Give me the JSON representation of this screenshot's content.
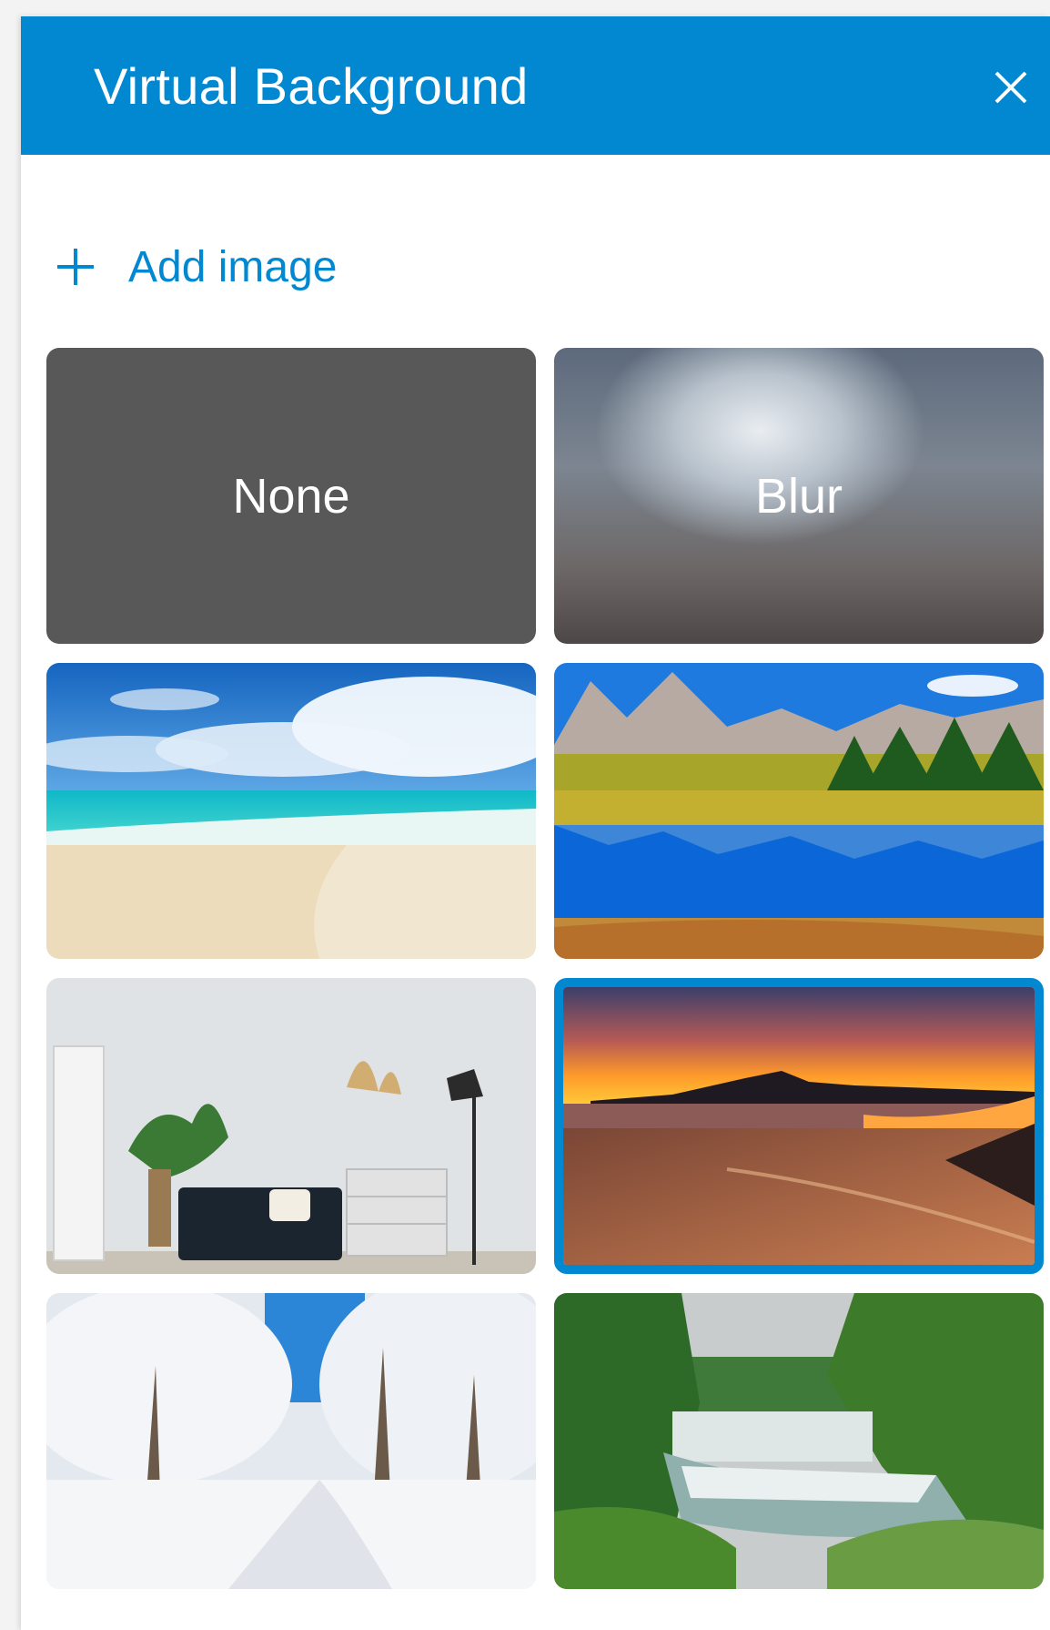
{
  "panel": {
    "title": "Virtual Background",
    "close_icon": "close-icon"
  },
  "actions": {
    "add_image_label": "Add image",
    "add_icon": "plus-icon"
  },
  "backgrounds": [
    {
      "id": "none",
      "label": "None",
      "selected": false
    },
    {
      "id": "blur",
      "label": "Blur",
      "selected": false
    },
    {
      "id": "beach",
      "label": "",
      "selected": false
    },
    {
      "id": "mountain-lake",
      "label": "",
      "selected": false
    },
    {
      "id": "living-room",
      "label": "",
      "selected": false
    },
    {
      "id": "sunset-beach",
      "label": "",
      "selected": true
    },
    {
      "id": "winter-forest",
      "label": "",
      "selected": false
    },
    {
      "id": "waterfall",
      "label": "",
      "selected": false
    }
  ],
  "colors": {
    "accent": "#0288d1",
    "none_tile": "#585858"
  }
}
